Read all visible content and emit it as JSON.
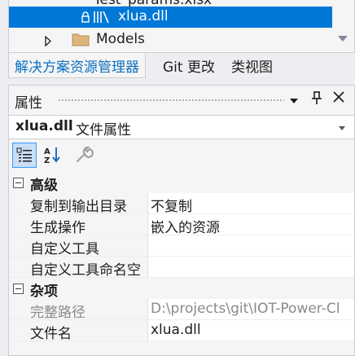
{
  "solution_explorer": {
    "clipped_item": "Test_params.xlsx",
    "selected_item": "xlua.dll",
    "folder_item": "Models",
    "tabs": [
      {
        "label": "解决方案资源管理器",
        "active": true
      },
      {
        "label": "Git 更改",
        "active": false
      },
      {
        "label": "类视图",
        "active": false
      }
    ],
    "selection_color": "#0078d7",
    "accent_color": "#0e70c0"
  },
  "properties": {
    "title": "属性",
    "object_name": "xlua.dll",
    "object_type": "文件属性",
    "toolbar_icons": [
      "categorized-icon",
      "alphabetical-icon",
      "property-pages-icon"
    ],
    "categories": [
      {
        "label": "高级",
        "rows": [
          {
            "name": "复制到输出目录",
            "value": "不复制"
          },
          {
            "name": "生成操作",
            "value": "嵌入的资源"
          },
          {
            "name": "自定义工具",
            "value": ""
          },
          {
            "name": "自定义工具命名空",
            "value": ""
          }
        ]
      },
      {
        "label": "杂项",
        "rows": [
          {
            "name": "完整路径",
            "value": "D:\\projects\\git\\IOT-Power-Cl",
            "readonly": true
          },
          {
            "name": "文件名",
            "value": "xlua.dll"
          }
        ]
      }
    ]
  }
}
